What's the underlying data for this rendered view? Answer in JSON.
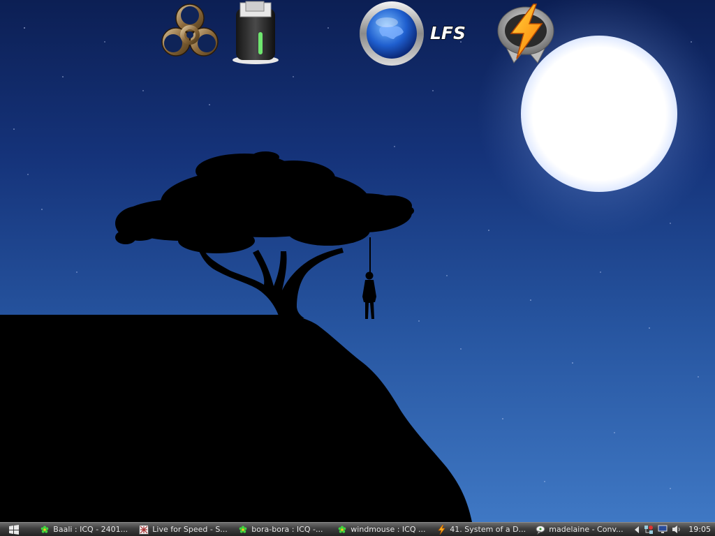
{
  "desktop": {
    "icons": [
      {
        "name": "biohazard-icon",
        "label": ""
      },
      {
        "name": "recycle-bin-icon",
        "label": ""
      },
      {
        "name": "browser-globe-icon",
        "label": ""
      },
      {
        "name": "lfs-icon",
        "label": "LFS"
      },
      {
        "name": "winamp-icon",
        "label": ""
      }
    ]
  },
  "taskbar": {
    "start_icon": "windows-flag-icon",
    "tasks": [
      {
        "icon": "icq-flower-icon",
        "label": "Baali : ICQ - 2401..."
      },
      {
        "icon": "lfs-window-icon",
        "label": "Live for Speed - S..."
      },
      {
        "icon": "icq-flower-icon",
        "label": "bora-bora : ICQ -..."
      },
      {
        "icon": "icq-flower-icon",
        "label": "windmouse : ICQ ..."
      },
      {
        "icon": "winamp-icon",
        "label": "41. System of a D..."
      },
      {
        "icon": "chat-bubble-icon",
        "label": "madelaine - Conv..."
      }
    ],
    "tray": {
      "icons": [
        "expand-arrow-icon",
        "network-icon",
        "monitor-icon",
        "volume-icon"
      ],
      "clock": "19:05"
    }
  },
  "colors": {
    "sky_top": "#0c1f54",
    "sky_bottom": "#3f78c4",
    "silhouette": "#000000",
    "icq_green": "#3fd43f",
    "taskbar": "#3d3d3d"
  }
}
